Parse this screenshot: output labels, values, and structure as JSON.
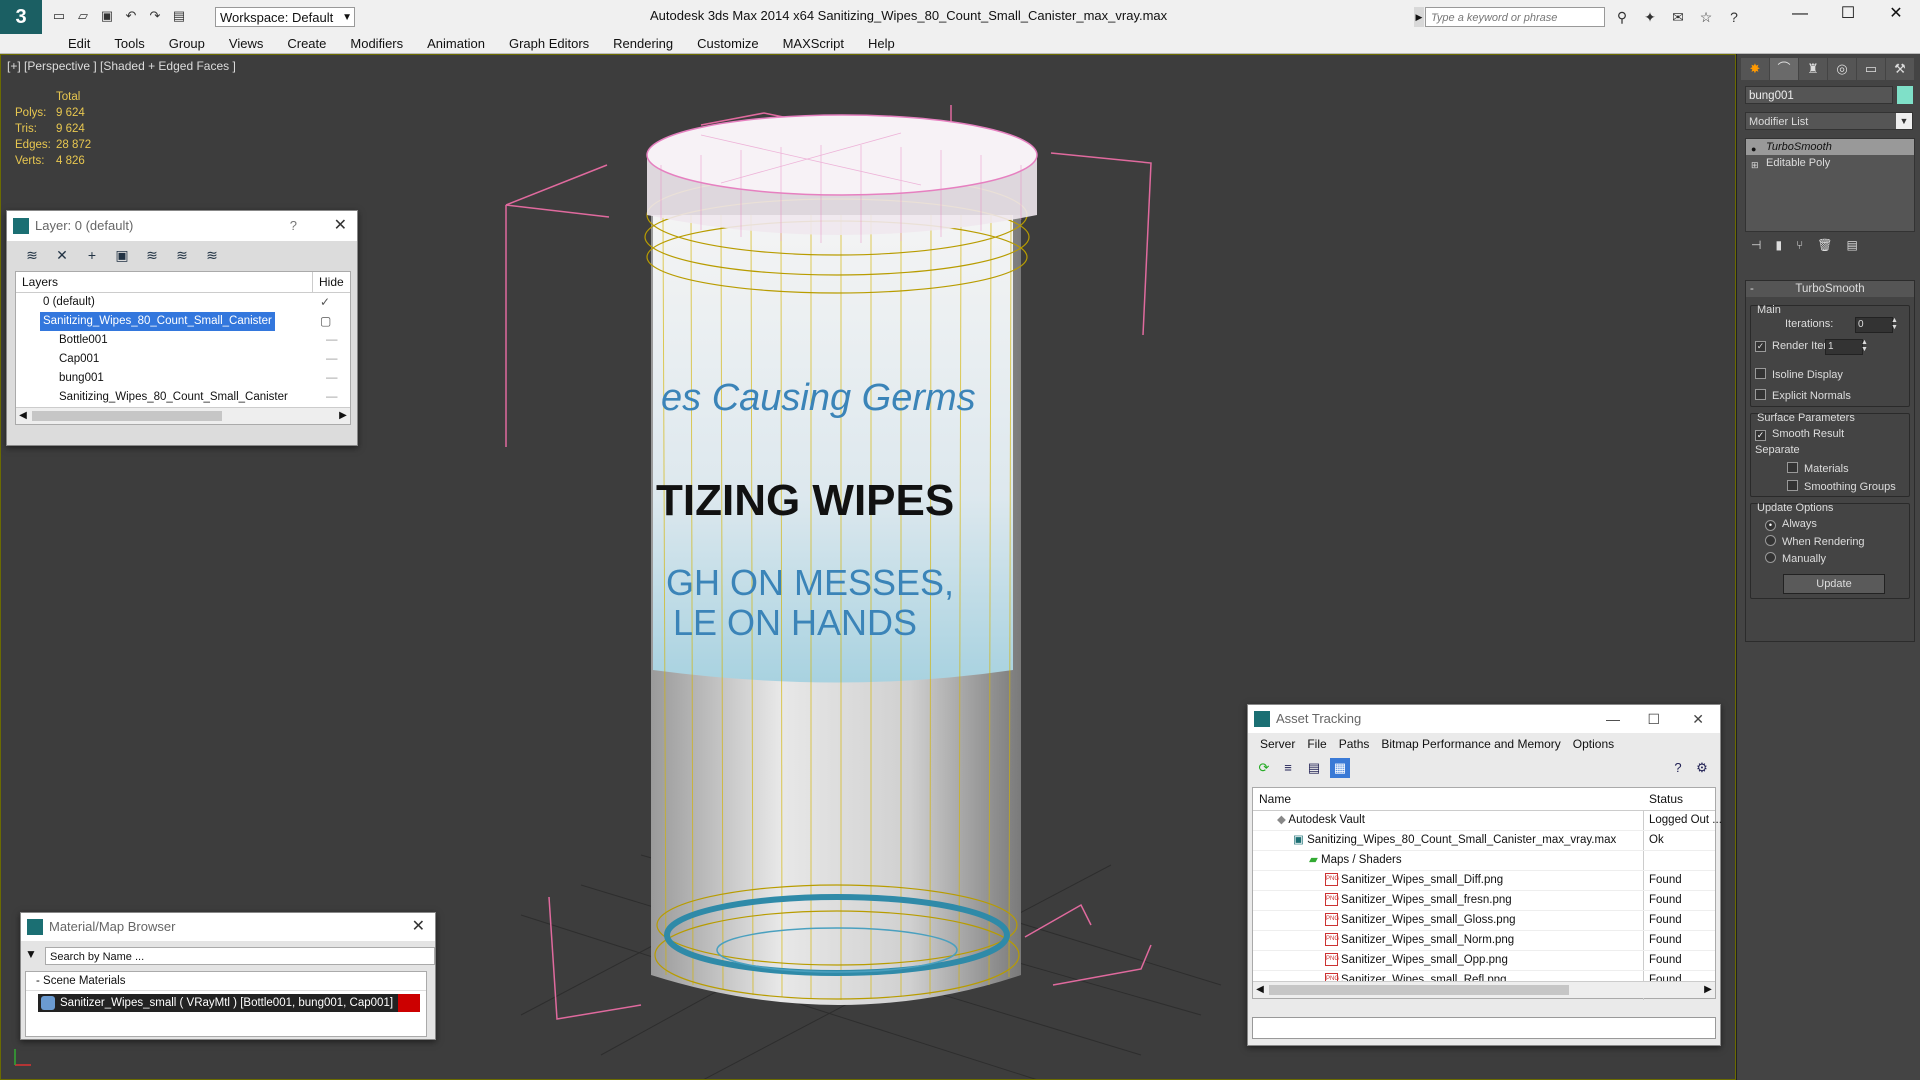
{
  "app": {
    "logo_text": "3",
    "workspace": "Workspace: Default",
    "window_title": "Autodesk 3ds Max  2014 x64     Sanitizing_Wipes_80_Count_Small_Canister_max_vray.max",
    "search_placeholder": "Type a keyword or phrase"
  },
  "menu": [
    "Edit",
    "Tools",
    "Group",
    "Views",
    "Create",
    "Modifiers",
    "Animation",
    "Graph Editors",
    "Rendering",
    "Customize",
    "MAXScript",
    "Help"
  ],
  "viewport": {
    "label": "[+] [Perspective ] [Shaded + Edged Faces ]",
    "stats": {
      "total_label": "Total",
      "rows": [
        {
          "k": "Polys:",
          "v": "9 624"
        },
        {
          "k": "Tris:",
          "v": "9 624"
        },
        {
          "k": "Edges:",
          "v": "28 872"
        },
        {
          "k": "Verts:",
          "v": "4 826"
        }
      ]
    },
    "label_text": {
      "line1": "es Causing Germs",
      "line2": "TIZING WIPES",
      "line3": "GH ON MESSES,",
      "line4": "LE ON HANDS"
    }
  },
  "layer_panel": {
    "title": "Layer: 0 (default)",
    "help": "?",
    "close": "✕",
    "col_layers": "Layers",
    "col_hide": "Hide",
    "rows": [
      {
        "name": "0 (default)",
        "indent": 1,
        "hide": "✓",
        "selected": false
      },
      {
        "name": "Sanitizing_Wipes_80_Count_Small_Canister",
        "indent": 1,
        "hide": "▢",
        "selected": true
      },
      {
        "name": "Bottle001",
        "indent": 2,
        "hide": "",
        "selected": false
      },
      {
        "name": "Cap001",
        "indent": 2,
        "hide": "",
        "selected": false
      },
      {
        "name": "bung001",
        "indent": 2,
        "hide": "",
        "selected": false
      },
      {
        "name": "Sanitizing_Wipes_80_Count_Small_Canister",
        "indent": 2,
        "hide": "",
        "selected": false
      }
    ]
  },
  "material_browser": {
    "title": "Material/Map Browser",
    "close": "✕",
    "search_placeholder": "Search by Name ...",
    "section": "- Scene Materials",
    "item": "Sanitizer_Wipes_small  ( VRayMtl ) [Bottle001, bung001, Cap001]"
  },
  "asset_tracking": {
    "title": "Asset Tracking",
    "menu": [
      "Server",
      "File",
      "Paths",
      "Bitmap Performance and Memory",
      "Options"
    ],
    "col_name": "Name",
    "col_status": "Status",
    "rows": [
      {
        "name": "Autodesk Vault",
        "indent": 1,
        "icon": "vault",
        "status": "Logged Out ..."
      },
      {
        "name": "Sanitizing_Wipes_80_Count_Small_Canister_max_vray.max",
        "indent": 2,
        "icon": "max",
        "status": "Ok"
      },
      {
        "name": "Maps / Shaders",
        "indent": 3,
        "icon": "maps",
        "status": ""
      },
      {
        "name": "Sanitizer_Wipes_small_Diff.png",
        "indent": 4,
        "icon": "png",
        "status": "Found"
      },
      {
        "name": "Sanitizer_Wipes_small_fresn.png",
        "indent": 4,
        "icon": "png",
        "status": "Found"
      },
      {
        "name": "Sanitizer_Wipes_small_Gloss.png",
        "indent": 4,
        "icon": "png",
        "status": "Found"
      },
      {
        "name": "Sanitizer_Wipes_small_Norm.png",
        "indent": 4,
        "icon": "png",
        "status": "Found"
      },
      {
        "name": "Sanitizer_Wipes_small_Opp.png",
        "indent": 4,
        "icon": "png",
        "status": "Found"
      },
      {
        "name": "Sanitizer_Wipes_small_Refl.png",
        "indent": 4,
        "icon": "png",
        "status": "Found"
      }
    ]
  },
  "command_panel": {
    "object_name": "bung001",
    "object_color": "#7fe0c8",
    "modifier_list": "Modifier List",
    "stack": [
      {
        "name": "TurboSmooth",
        "selected": true
      },
      {
        "name": "Editable Poly",
        "selected": false
      }
    ],
    "rollout_title": "TurboSmooth",
    "main_label": "Main",
    "iterations_label": "Iterations:",
    "iterations_value": "0",
    "render_iters_label": "Render Iters:",
    "render_iters_value": "1",
    "isoline": "Isoline Display",
    "explicit_normals": "Explicit Normals",
    "surface_params": "Surface Parameters",
    "smooth_result": "Smooth Result",
    "separate": "Separate",
    "materials": "Materials",
    "smoothing_groups": "Smoothing Groups",
    "update_options": "Update Options",
    "always": "Always",
    "when_rendering": "When Rendering",
    "manually": "Manually",
    "update_btn": "Update"
  }
}
